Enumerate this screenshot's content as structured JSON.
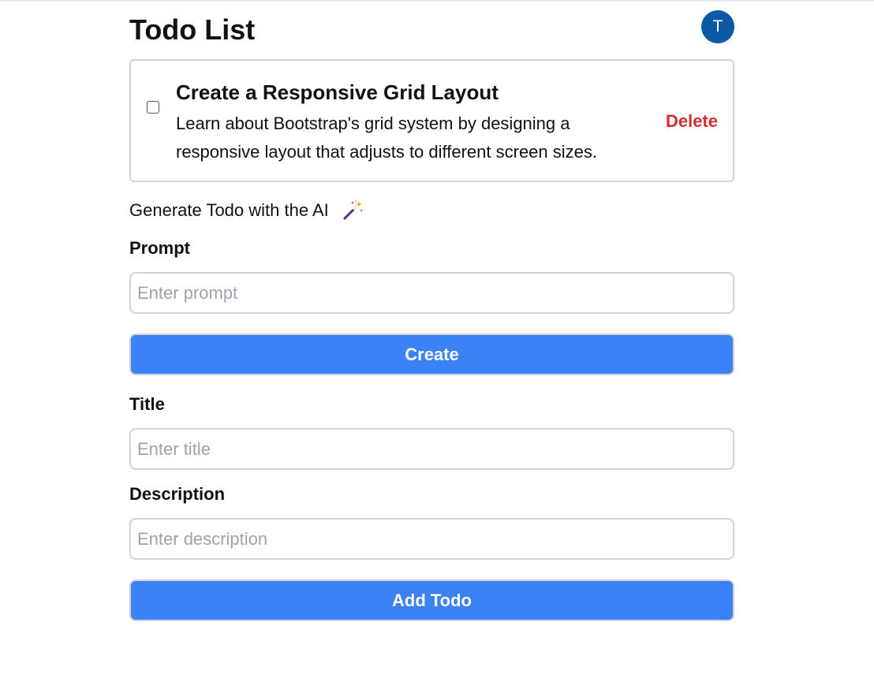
{
  "header": {
    "title": "Todo List",
    "avatar_initial": "T"
  },
  "todos": [
    {
      "title": "Create a Responsive Grid Layout",
      "description": "Learn about Bootstrap's grid system by designing a responsive layout that adjusts to different screen sizes.",
      "completed": false,
      "delete_label": "Delete"
    }
  ],
  "generator": {
    "heading": "Generate Todo with the AI",
    "icon": "magic-wand-icon",
    "prompt_label": "Prompt",
    "prompt_placeholder": "Enter prompt",
    "prompt_value": "",
    "create_label": "Create"
  },
  "form": {
    "title_label": "Title",
    "title_placeholder": "Enter title",
    "description_label": "Description",
    "description_placeholder": "Enter description",
    "submit_label": "Add Todo"
  },
  "colors": {
    "primary_button": "#3b82f6",
    "delete_text": "#d32f2f",
    "avatar_bg": "#0b5aa3",
    "border": "#d1d5db"
  }
}
